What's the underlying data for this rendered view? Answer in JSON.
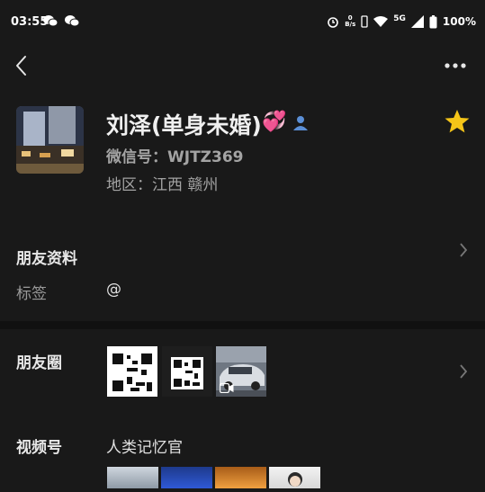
{
  "status_bar": {
    "time": "03:55",
    "net_speed_top": "0",
    "net_speed_bottom": "B/s",
    "network": "5G",
    "battery": "100%"
  },
  "profile": {
    "name": "刘泽(单身未婚)",
    "emoji": "💞",
    "wechat_id": "微信号：WJTZ369",
    "region": "地区：江西  赣州"
  },
  "sections": {
    "friend_info": "朋友资料",
    "tag_label": "标签",
    "tag_value": "@",
    "moments": "朋友圈",
    "channels": "视频号",
    "channels_value": "人类记忆官"
  },
  "colors": {
    "background": "#191919",
    "star": "#f5c518",
    "person_icon": "#5b8fd6"
  },
  "icons": [
    "back-icon",
    "more-icon",
    "star-icon",
    "person-icon",
    "chevron-right-icon",
    "video-icon"
  ]
}
